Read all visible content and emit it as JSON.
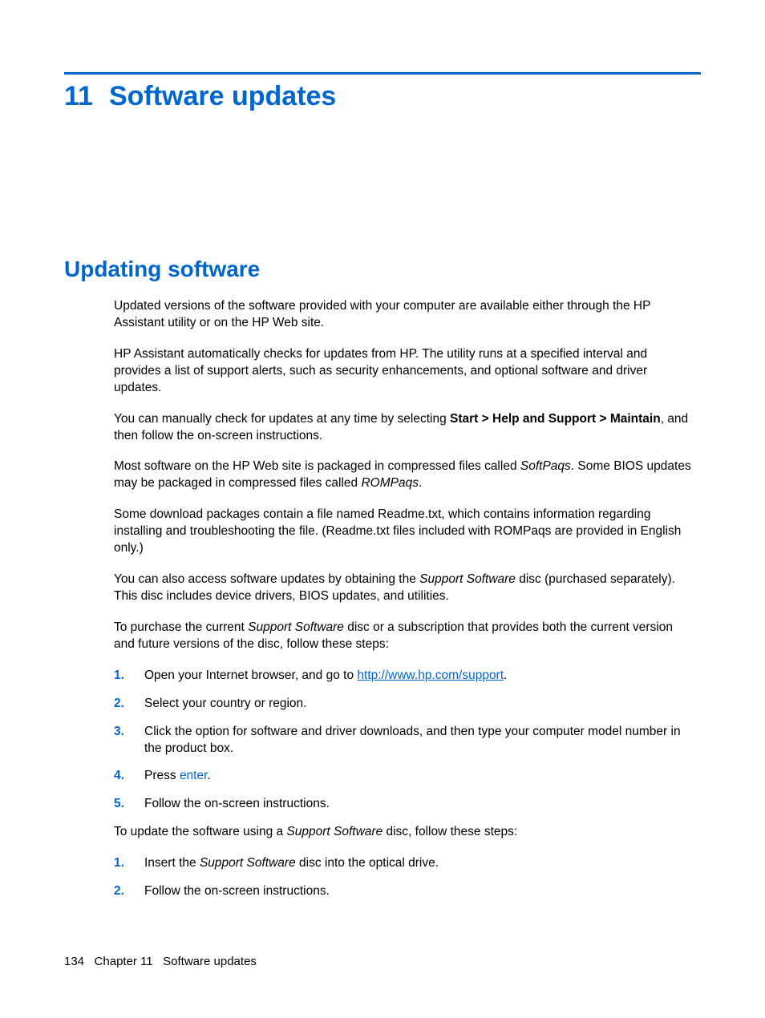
{
  "chapter": {
    "number": "11",
    "title": "Software updates"
  },
  "section": {
    "heading": "Updating software"
  },
  "paragraphs": {
    "p1": "Updated versions of the software provided with your computer are available either through the HP Assistant utility or on the HP Web site.",
    "p2": "HP Assistant automatically checks for updates from HP. The utility runs at a specified interval and provides a list of support alerts, such as security enhancements, and optional software and driver updates.",
    "p3_a": "You can manually check for updates at any time by selecting ",
    "p3_bold": "Start > Help and Support > Maintain",
    "p3_b": ", and then follow the on-screen instructions.",
    "p4_a": "Most software on the HP Web site is packaged in compressed files called ",
    "p4_i1": "SoftPaqs",
    "p4_b": ". Some BIOS updates may be packaged in compressed files called ",
    "p4_i2": "ROMPaqs",
    "p4_c": ".",
    "p5": "Some download packages contain a file named Readme.txt, which contains information regarding installing and troubleshooting the file. (Readme.txt files included with ROMPaqs are provided in English only.)",
    "p6_a": "You can also access software updates by obtaining the ",
    "p6_i": "Support Software",
    "p6_b": " disc (purchased separately). This disc includes device drivers, BIOS updates, and utilities.",
    "p7_a": "To purchase the current ",
    "p7_i": "Support Software",
    "p7_b": " disc or a subscription that provides both the current version and future versions of the disc, follow these steps:",
    "p8_a": "To update the software using a ",
    "p8_i": "Support Software",
    "p8_b": " disc, follow these steps:"
  },
  "steps1": {
    "s1_a": "Open your Internet browser, and go to ",
    "s1_link": "http://www.hp.com/support",
    "s1_b": ".",
    "s2": "Select your country or region.",
    "s3": "Click the option for software and driver downloads, and then type your computer model number in the product box.",
    "s4_a": "Press ",
    "s4_key": "enter",
    "s4_b": ".",
    "s5": "Follow the on-screen instructions."
  },
  "steps2": {
    "s1_a": "Insert the ",
    "s1_i": "Support Software",
    "s1_b": " disc into the optical drive.",
    "s2": "Follow the on-screen instructions."
  },
  "footer": {
    "page": "134",
    "chapter_label": "Chapter 11",
    "chapter_title": "Software updates"
  }
}
